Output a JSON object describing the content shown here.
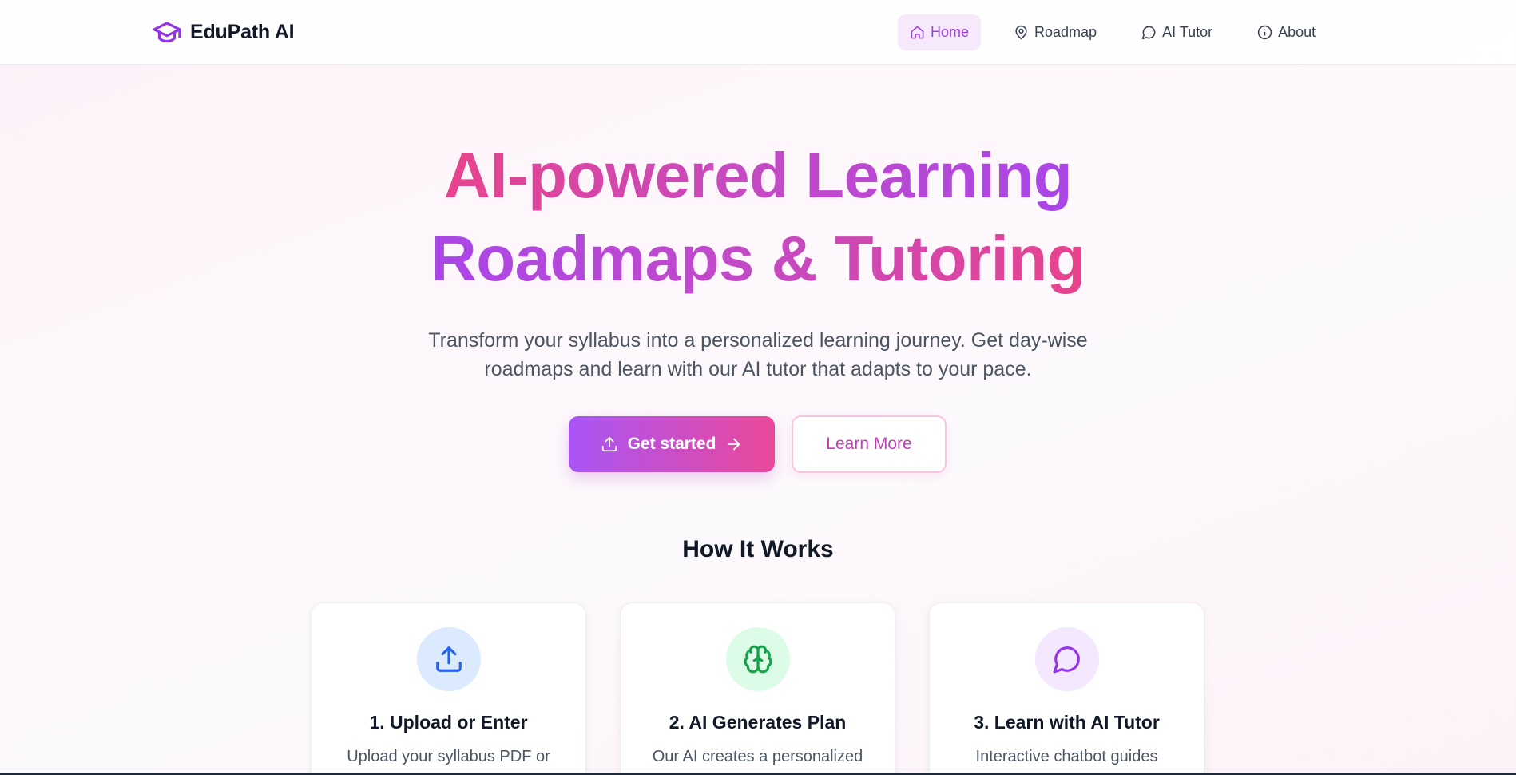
{
  "brand": {
    "name": "EduPath AI"
  },
  "nav": {
    "items": [
      {
        "label": "Home",
        "icon": "home-icon",
        "active": true
      },
      {
        "label": "Roadmap",
        "icon": "map-pin-icon"
      },
      {
        "label": "AI Tutor",
        "icon": "chat-bubble-icon"
      },
      {
        "label": "About",
        "icon": "info-icon"
      }
    ]
  },
  "hero": {
    "title_line1": "AI-powered Learning",
    "title_line2": "Roadmaps & Tutoring",
    "subtitle_line1": "Transform your syllabus into a personalized learning journey. Get day-wise",
    "subtitle_line2": "roadmaps and learn with our AI tutor that adapts to your pace.",
    "primary_cta": "Get started",
    "secondary_cta": "Learn More"
  },
  "how_it_works": {
    "title": "How It Works",
    "steps": [
      {
        "title": "1. Upload or Enter",
        "text": "Upload your syllabus PDF or",
        "icon": "upload-icon",
        "icon_color": "#2563eb",
        "icon_bg": "#dbeafe"
      },
      {
        "title": "2. AI Generates Plan",
        "text": "Our AI creates a personalized",
        "icon": "brain-icon",
        "icon_color": "#16a34a",
        "icon_bg": "#dcfce7"
      },
      {
        "title": "3. Learn with AI Tutor",
        "text": "Interactive chatbot guides",
        "icon": "chat-bubble-icon",
        "icon_color": "#9333ea",
        "icon_bg": "#f3e8ff"
      }
    ]
  },
  "colors": {
    "accent_purple": "#a855f7",
    "accent_pink": "#ec4899",
    "nav_active_bg": "#f6e9fb",
    "nav_active_text": "#9b3fe0"
  }
}
